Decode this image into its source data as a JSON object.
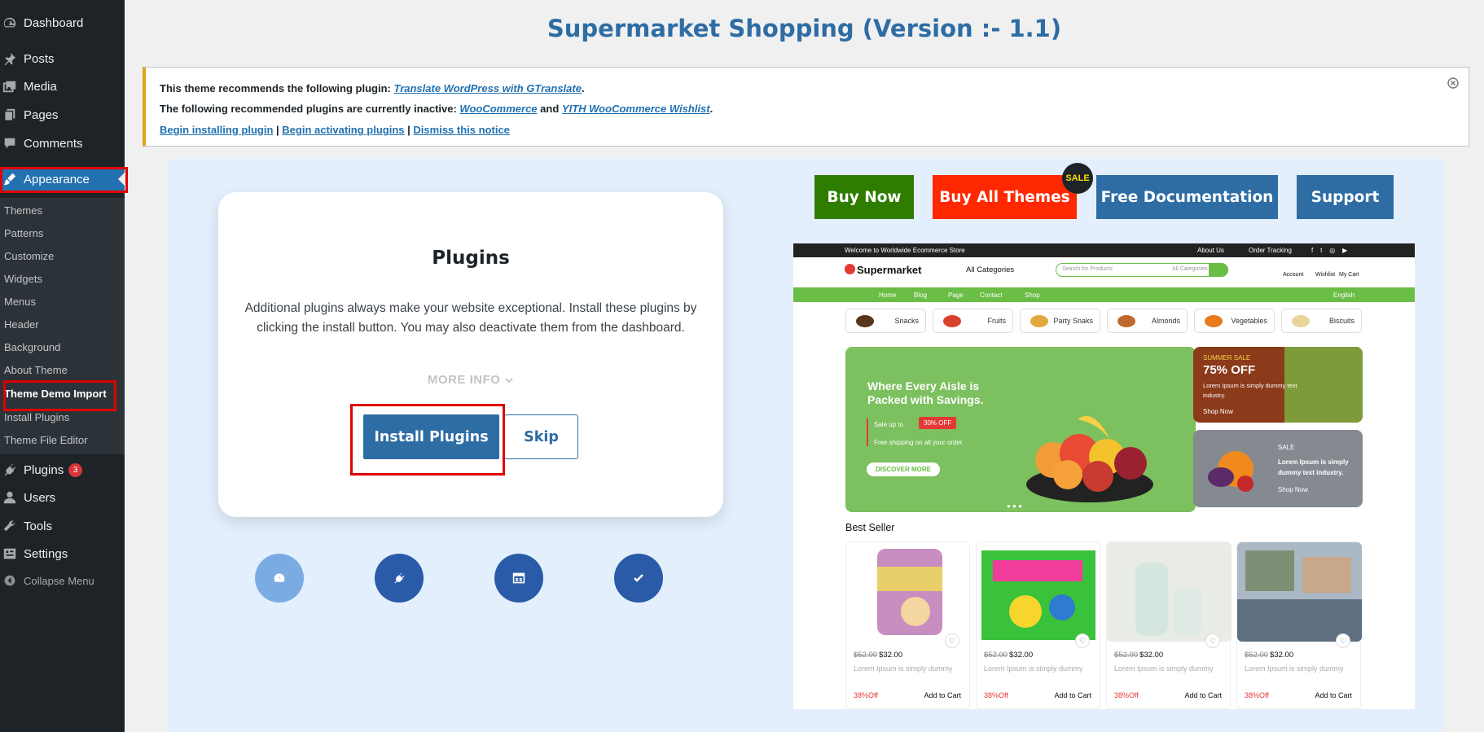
{
  "sidebar": {
    "menu": {
      "dashboard": "Dashboard",
      "posts": "Posts",
      "media": "Media",
      "pages": "Pages",
      "comments": "Comments",
      "appearance": "Appearance",
      "plugins": "Plugins",
      "plugins_badge": "3",
      "users": "Users",
      "tools": "Tools",
      "settings": "Settings",
      "collapse": "Collapse Menu"
    },
    "submenu": [
      "Themes",
      "Patterns",
      "Customize",
      "Widgets",
      "Menus",
      "Header",
      "Background",
      "About Theme",
      "Theme Demo Import",
      "Install Plugins",
      "Theme File Editor"
    ],
    "current_submenu": "Theme Demo Import"
  },
  "page_title": "Supermarket Shopping (Version :- 1.1)",
  "notice": {
    "line1_prefix": "This theme recommends the following plugin:",
    "line1_link": "Translate WordPress with GTranslate",
    "line1_end": ".",
    "line2_prefix": "The following recommended plugins are currently inactive:",
    "line2_link1": "WooCommerce",
    "line2_and": "and",
    "line2_link2": "YITH WooCommerce Wishlist",
    "line2_end": ".",
    "action_install": "Begin installing plugin",
    "action_activate": "Begin activating plugins",
    "action_dismiss": "Dismiss this notice",
    "separator": "|"
  },
  "wizard": {
    "title": "Plugins",
    "description": "Additional plugins always make your website exceptional. Install these plugins by clicking the install button. You may also deactivate them from the dashboard.",
    "more_info": "MORE INFO",
    "install_button": "Install Plugins",
    "skip_button": "Skip",
    "steps": [
      "dashboard-icon",
      "plugin-icon",
      "layout-icon",
      "check-icon"
    ]
  },
  "top_buttons": {
    "buy_now": "Buy Now",
    "buy_all": "Buy All Themes",
    "sale_badge": "SALE",
    "docs": "Free Documentation",
    "support": "Support"
  },
  "colors": {
    "accent": "#2e6da4",
    "buy_now": "#2f7d00",
    "buy_all": "#ff2800",
    "highlight_box": "#e00000"
  },
  "preview": {
    "topbar_left": "Welcome to Worldwide Ecommerce Store",
    "topbar_about": "About Us",
    "topbar_tracking": "Order Tracking",
    "logo": "Supermarket",
    "all_categories": "All Categories",
    "search_placeholder": "Search for Products",
    "search_select": "All Categories",
    "account": "Account",
    "wishlist": "Wishlist",
    "cart": "My Cart",
    "nav": [
      "Home",
      "Blog",
      "Page",
      "Contact",
      "Shop"
    ],
    "language": "English",
    "categories": [
      "Snacks",
      "Fruits",
      "Party Snaks",
      "Almonds",
      "Vegetables",
      "Biscuits"
    ],
    "banner_title": "Where Every Aisle is Packed with Savings.",
    "banner_sale": "Sale up to",
    "banner_badge": "30% OFF",
    "banner_shipping": "Free shipping on all your order.",
    "banner_button": "DISCOVER MORE",
    "promo1_tag": "SUMMER SALE",
    "promo1_big": "75% OFF",
    "promo1_text": "Lorem Ipsum is simply dummy text industry.",
    "promo1_link": "Shop Now",
    "promo2_tag": "SALE",
    "promo2_text": "Lorem Ipsum is simply dummy text industry.",
    "promo2_link": "Shop Now",
    "best_seller": "Best Seller",
    "products": [
      {
        "old": "$52.00",
        "price": "$32.00",
        "desc": "Lorem Ipsum is simply dummy",
        "off": "38%Off",
        "cart": "Add to Cart"
      },
      {
        "old": "$52.00",
        "price": "$32.00",
        "desc": "Lorem Ipsum is simply dummy",
        "off": "38%Off",
        "cart": "Add to Cart"
      },
      {
        "old": "$52.00",
        "price": "$32.00",
        "desc": "Lorem Ipsum is simply dummy",
        "off": "38%Off",
        "cart": "Add to Cart"
      },
      {
        "old": "$52.00",
        "price": "$32.00",
        "desc": "Lorem Ipsum is simply dummy",
        "off": "38%Off",
        "cart": "Add to Cart"
      }
    ]
  }
}
